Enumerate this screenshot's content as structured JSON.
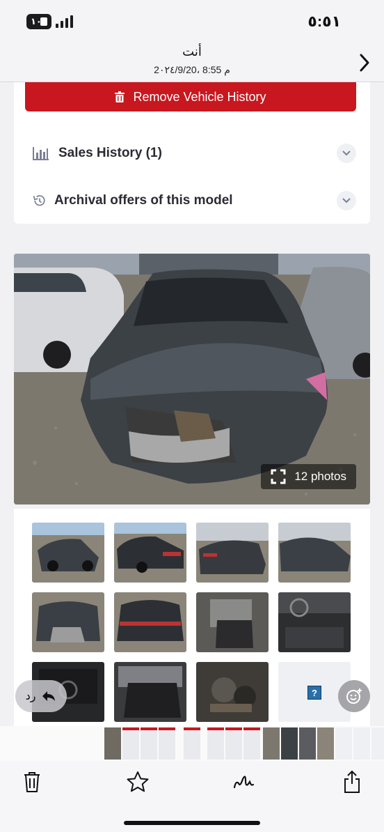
{
  "status_bar": {
    "time": "٥:٥١",
    "battery_level": "١٠"
  },
  "header": {
    "sender": "أنت",
    "timestamp": "2٠٢٤/9/20، 8:55 م"
  },
  "listing": {
    "remove_history_label": "Remove Vehicle History",
    "sections": [
      {
        "label": "Sales History (1)",
        "icon": "bar-chart-icon"
      },
      {
        "label": "Archival offers of this model",
        "icon": "history-icon"
      }
    ],
    "photos_badge": "12 photos",
    "thumbnail_count": 12
  },
  "overlay": {
    "reply_label": "رد"
  },
  "toolbar": {
    "items": [
      "trash-icon",
      "star-icon",
      "markup-icon",
      "share-icon"
    ]
  },
  "colors": {
    "remove_button": "#c8171f",
    "text_dark": "#2b2b33"
  }
}
